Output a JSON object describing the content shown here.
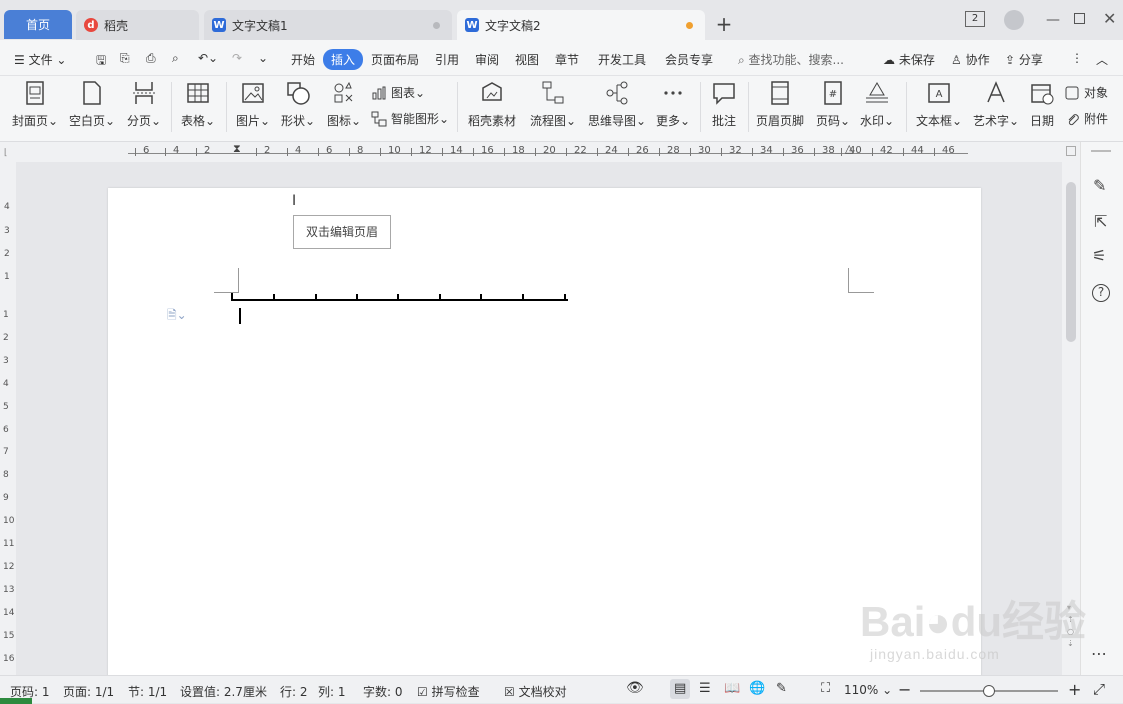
{
  "tabs": {
    "home": "首页",
    "daoke": "稻壳",
    "doc1": "文字文稿1",
    "doc2": "文字文稿2",
    "doc1_dot_color": "#b8b9bd",
    "doc2_dot_color": "#f0a030",
    "window_count": "2"
  },
  "menu": {
    "file": "文件",
    "items": [
      "开始",
      "插入",
      "页面布局",
      "引用",
      "审阅",
      "视图",
      "章节",
      "开发工具",
      "会员专享"
    ],
    "search_placeholder": "查找功能、搜索...",
    "unsaved": "未保存",
    "collab": "协作",
    "share": "分享"
  },
  "ribbon": {
    "cover": "封面页",
    "blank": "空白页",
    "pagebreak": "分页",
    "table": "表格",
    "picture": "图片",
    "shape": "形状",
    "icon": "图标",
    "chart": "图表",
    "smartart": "智能图形",
    "daoke_material": "稻壳素材",
    "flowchart": "流程图",
    "mindmap": "思维导图",
    "more": "更多",
    "comment": "批注",
    "header_footer": "页眉页脚",
    "page_number": "页码",
    "watermark": "水印",
    "textbox": "文本框",
    "wordart": "艺术字",
    "date": "日期",
    "object": "对象",
    "attachment": "附件"
  },
  "ruler": {
    "h_ticks": [
      "6",
      "4",
      "2",
      "2",
      "4",
      "6",
      "8",
      "10",
      "12",
      "14",
      "16",
      "18",
      "20",
      "22",
      "24",
      "26",
      "28",
      "30",
      "32",
      "34",
      "36",
      "38",
      "40",
      "42",
      "44",
      "46"
    ],
    "v_ticks_top": [
      "4",
      "3",
      "2",
      "1"
    ],
    "v_ticks": [
      "1",
      "2",
      "3",
      "4",
      "5",
      "6",
      "7",
      "8",
      "9",
      "10",
      "11",
      "12",
      "13",
      "14",
      "15",
      "16"
    ]
  },
  "document": {
    "header_tooltip": "双击编辑页眉"
  },
  "status": {
    "page_num": "页码: 1",
    "pages": "页面: 1/1",
    "section": "节: 1/1",
    "setting": "设置值: 2.7厘米",
    "row": "行: 2",
    "col": "列: 1",
    "words": "字数: 0",
    "spellcheck": "拼写检查",
    "doc_proof": "文档校对",
    "zoom": "110%",
    "zoom_level": 0.5
  },
  "colors": {
    "accent": "#3d7de8",
    "home_tab": "#4a7fd6"
  }
}
